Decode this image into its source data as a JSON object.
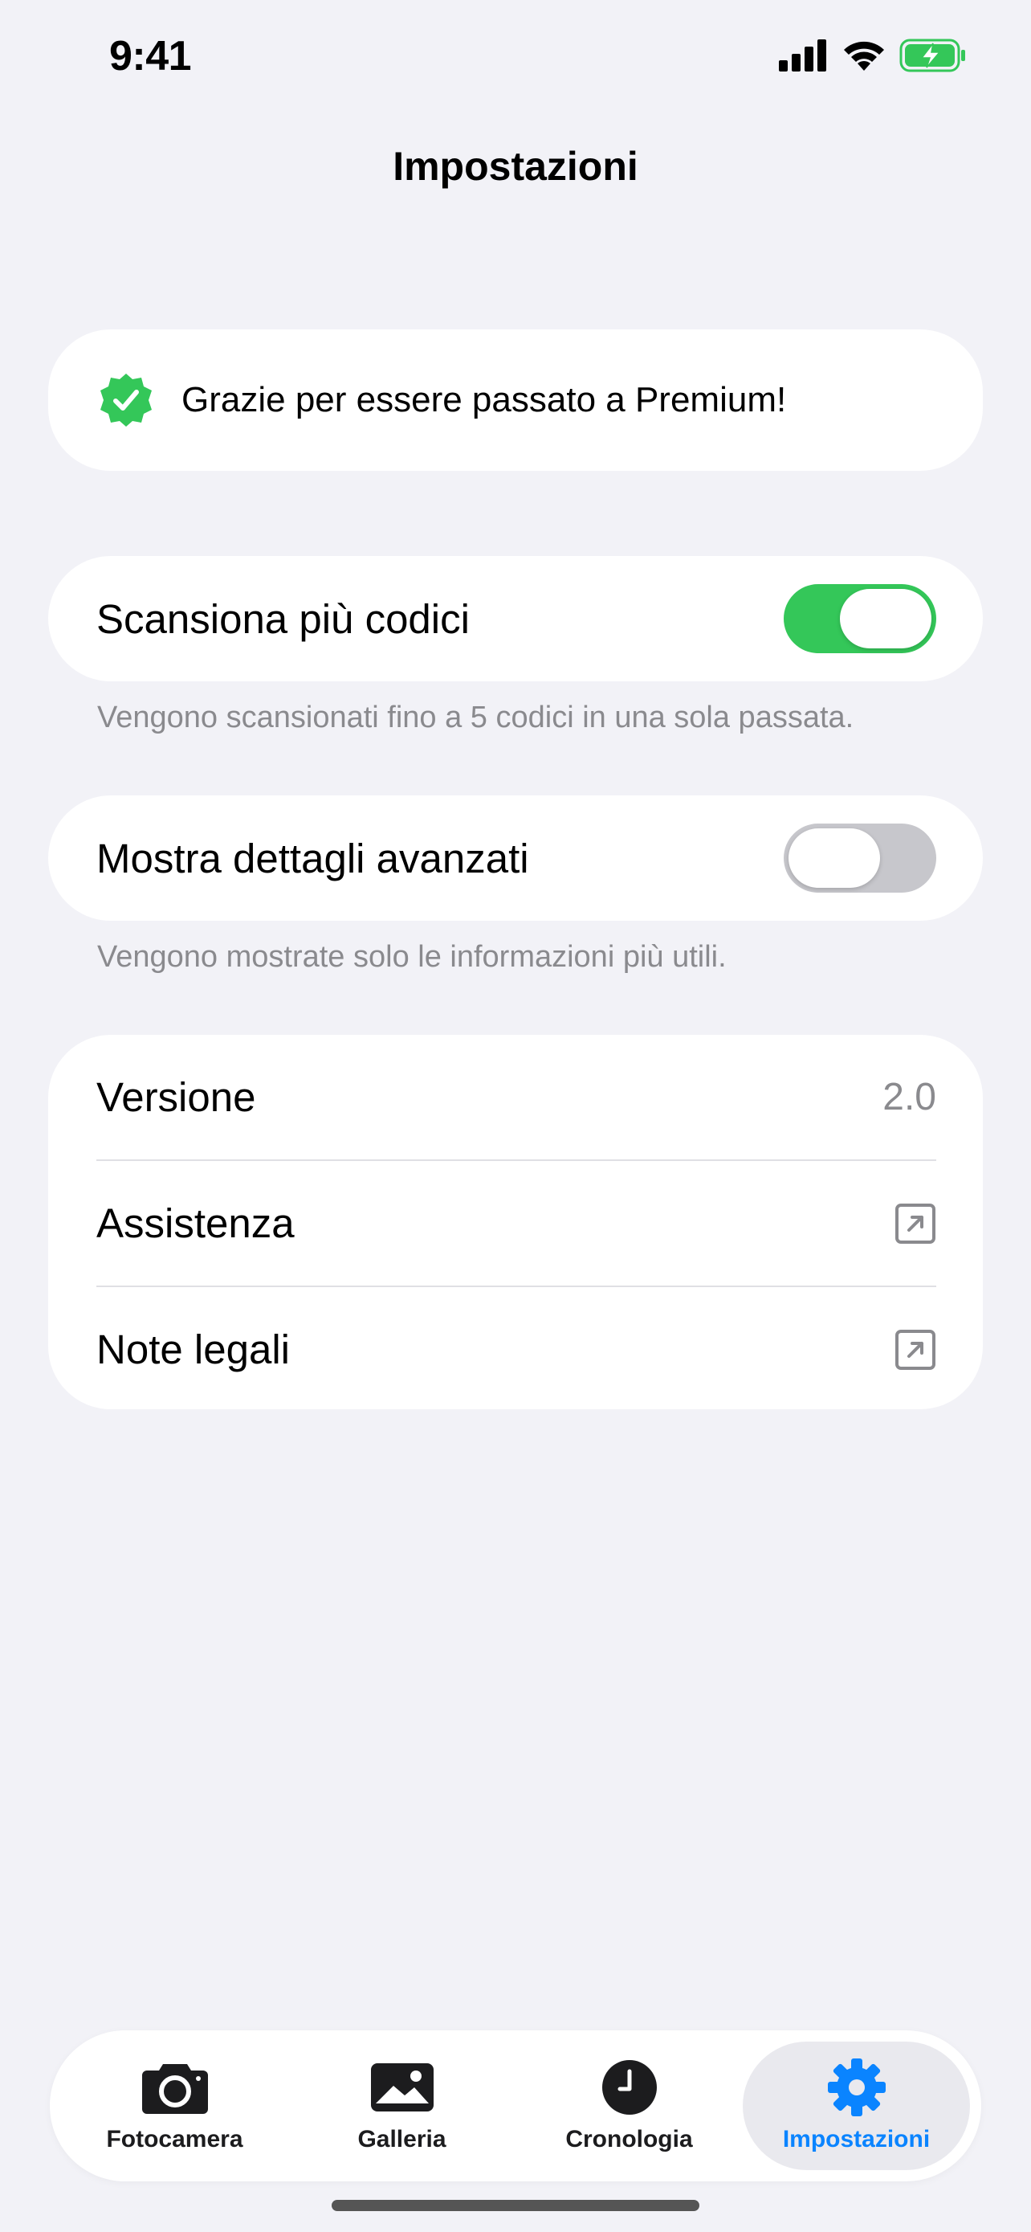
{
  "status_bar": {
    "time": "9:41"
  },
  "nav": {
    "title": "Impostazioni"
  },
  "premium": {
    "message": "Grazie per essere passato a Premium!"
  },
  "settings": {
    "multi_scan": {
      "label": "Scansiona più codici",
      "enabled": true,
      "footnote": "Vengono scansionati fino a 5 codici in una sola passata."
    },
    "advanced_details": {
      "label": "Mostra dettagli avanzati",
      "enabled": false,
      "footnote": "Vengono mostrate solo le informazioni più utili."
    }
  },
  "info": {
    "version_label": "Versione",
    "version_value": "2.0",
    "support_label": "Assistenza",
    "legal_label": "Note legali"
  },
  "tabs": [
    {
      "label": "Fotocamera",
      "icon": "camera-icon",
      "active": false
    },
    {
      "label": "Galleria",
      "icon": "photo-icon",
      "active": false
    },
    {
      "label": "Cronologia",
      "icon": "clock-icon",
      "active": false
    },
    {
      "label": "Impostazioni",
      "icon": "gear-icon",
      "active": true
    }
  ],
  "colors": {
    "accent": "#0A84FF",
    "success": "#34C759",
    "background": "#F2F2F7"
  }
}
